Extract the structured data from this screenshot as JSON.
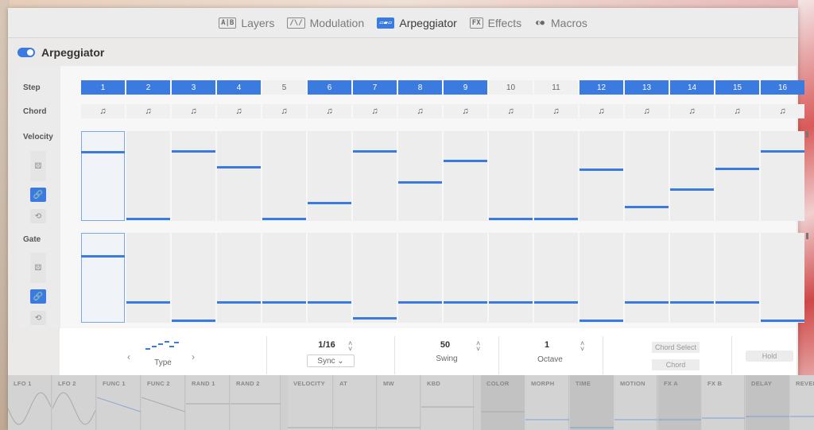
{
  "nav": {
    "tabs": [
      {
        "label": "Layers",
        "icon": "A|B"
      },
      {
        "label": "Modulation",
        "icon": "/\\/"
      },
      {
        "label": "Arpeggiator",
        "icon": "▱▰▱"
      },
      {
        "label": "Effects",
        "icon": "FX"
      },
      {
        "label": "Macros",
        "icon": "◐●"
      }
    ],
    "active": "Arpeggiator"
  },
  "section": {
    "title": "Arpeggiator",
    "enabled": true
  },
  "rows": {
    "step": "Step",
    "chord": "Chord",
    "velocity": "Velocity",
    "gate": "Gate"
  },
  "steps": [
    {
      "label": "1",
      "on": true
    },
    {
      "label": "2",
      "on": true
    },
    {
      "label": "3",
      "on": true
    },
    {
      "label": "4",
      "on": true
    },
    {
      "label": "5",
      "on": false
    },
    {
      "label": "6",
      "on": true
    },
    {
      "label": "7",
      "on": true
    },
    {
      "label": "8",
      "on": true
    },
    {
      "label": "9",
      "on": true
    },
    {
      "label": "10",
      "on": false
    },
    {
      "label": "11",
      "on": false
    },
    {
      "label": "12",
      "on": true
    },
    {
      "label": "13",
      "on": true
    },
    {
      "label": "14",
      "on": true
    },
    {
      "label": "15",
      "on": true
    },
    {
      "label": "16",
      "on": true
    }
  ],
  "chord_glyph": "♫",
  "velocity_levels": [
    0.78,
    0.0,
    0.78,
    0.6,
    0.0,
    0.18,
    0.78,
    0.42,
    0.67,
    0.0,
    0.0,
    0.57,
    0.14,
    0.34,
    0.58,
    0.78
  ],
  "gate_levels": [
    0.75,
    0.21,
    0.0,
    0.21,
    0.21,
    0.21,
    0.03,
    0.21,
    0.21,
    0.21,
    0.21,
    0.0,
    0.21,
    0.21,
    0.21,
    0.0
  ],
  "bottom": {
    "type_label": "Type",
    "rate_value": "1/16",
    "sync_label": "Sync",
    "swing_value": "50",
    "swing_label": "Swing",
    "octave_value": "1",
    "octave_label": "Octave",
    "chord_select_label": "Chord Select",
    "chord_label": "Chord",
    "hold_label": "Hold"
  },
  "mod_sources": [
    {
      "label": "LFO 1"
    },
    {
      "label": "LFO 2"
    },
    {
      "label": "FUNC 1"
    },
    {
      "label": "FUNC 2"
    },
    {
      "label": "RAND 1"
    },
    {
      "label": "RAND 2"
    },
    {
      "label": "VELOCITY"
    },
    {
      "label": "AT"
    },
    {
      "label": "MW"
    },
    {
      "label": "KBD"
    },
    {
      "label": "COLOR"
    },
    {
      "label": "MORPH"
    },
    {
      "label": "TIME"
    },
    {
      "label": "MOTION"
    },
    {
      "label": "FX A"
    },
    {
      "label": "FX B"
    },
    {
      "label": "DELAY"
    },
    {
      "label": "REVERB"
    }
  ],
  "colors": {
    "accent": "#3b7be0"
  }
}
